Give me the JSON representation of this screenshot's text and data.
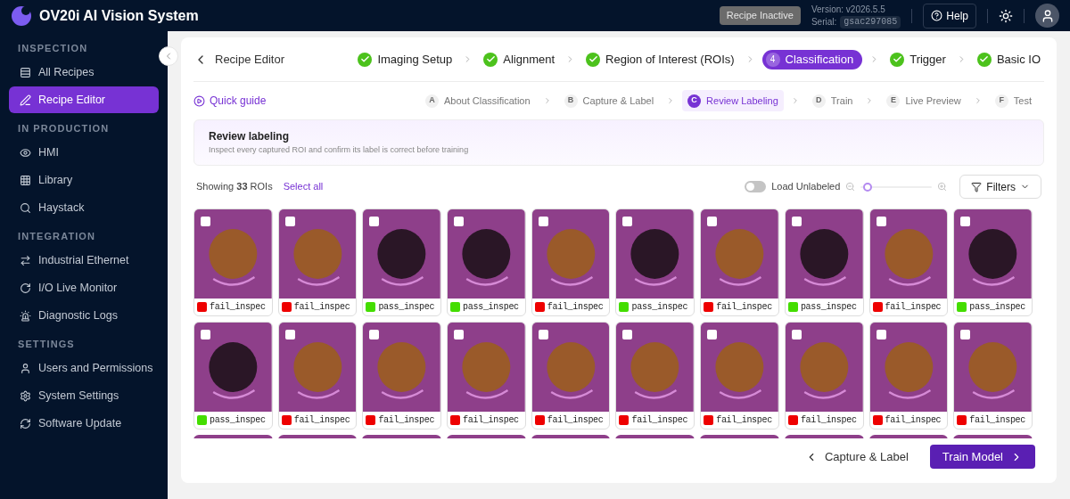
{
  "header": {
    "title": "OV20i AI Vision System",
    "status_badge": "Recipe Inactive",
    "version": "Version: v2026.5.5",
    "serial_label": "Serial:",
    "serial": "gsac297085",
    "help": "Help"
  },
  "sidebar": {
    "sections": [
      {
        "title": "INSPECTION",
        "items": [
          {
            "label": "All Recipes",
            "selected": false
          },
          {
            "label": "Recipe Editor",
            "selected": true
          }
        ]
      },
      {
        "title": "IN PRODUCTION",
        "items": [
          {
            "label": "HMI",
            "selected": false
          },
          {
            "label": "Library",
            "selected": false
          },
          {
            "label": "Haystack",
            "selected": false
          }
        ]
      },
      {
        "title": "INTEGRATION",
        "items": [
          {
            "label": "Industrial Ethernet",
            "selected": false
          },
          {
            "label": "I/O Live Monitor",
            "selected": false
          },
          {
            "label": "Diagnostic Logs",
            "selected": false
          }
        ]
      },
      {
        "title": "SETTINGS",
        "items": [
          {
            "label": "Users and Permissions",
            "selected": false
          },
          {
            "label": "System Settings",
            "selected": false
          },
          {
            "label": "Software Update",
            "selected": false
          }
        ]
      }
    ]
  },
  "editor": {
    "back": "Recipe Editor",
    "steps": [
      {
        "label": "Imaging Setup",
        "selected": false
      },
      {
        "label": "Alignment",
        "selected": false
      },
      {
        "label": "Region of Interest (ROIs)",
        "selected": false
      },
      {
        "label": "Classification",
        "number": "4",
        "selected": true
      },
      {
        "label": "Trigger",
        "selected": false
      },
      {
        "label": "Basic IO",
        "selected": false
      }
    ],
    "quick_guide": "Quick guide",
    "substeps": [
      {
        "letter": "A",
        "label": "About Classification",
        "selected": false
      },
      {
        "letter": "B",
        "label": "Capture & Label",
        "selected": false
      },
      {
        "letter": "C",
        "label": "Review Labeling",
        "selected": true
      },
      {
        "letter": "D",
        "label": "Train",
        "selected": false
      },
      {
        "letter": "E",
        "label": "Live Preview",
        "selected": false
      },
      {
        "letter": "F",
        "label": "Test",
        "selected": false
      }
    ],
    "banner": {
      "title": "Review labeling",
      "subtitle": "Inspect every captured ROI and confirm its label is correct before training"
    },
    "toolbar": {
      "showing": "Showing **33** ROIs",
      "select_all": "Select all",
      "load_unlabeled": {
        "label": "Load Unlabeled",
        "on": false
      },
      "zoom": {
        "level": 0.1
      },
      "filters": "Filters"
    },
    "tiles": [
      {
        "label": "fail_inspec",
        "color": "#ee0000",
        "checked": false,
        "kind": "fail"
      },
      {
        "label": "fail_inspec",
        "color": "#ee0000",
        "checked": false,
        "kind": "fail"
      },
      {
        "label": "pass_inspec",
        "color": "#44dd00",
        "checked": false,
        "kind": "pass"
      },
      {
        "label": "pass_inspec",
        "color": "#44dd00",
        "checked": false,
        "kind": "pass"
      },
      {
        "label": "fail_inspec",
        "color": "#ee0000",
        "checked": false,
        "kind": "fail"
      },
      {
        "label": "pass_inspec",
        "color": "#44dd00",
        "checked": false,
        "kind": "pass"
      },
      {
        "label": "fail_inspec",
        "color": "#ee0000",
        "checked": false,
        "kind": "fail"
      },
      {
        "label": "pass_inspec",
        "color": "#44dd00",
        "checked": false,
        "kind": "pass"
      },
      {
        "label": "fail_inspec",
        "color": "#ee0000",
        "checked": false,
        "kind": "fail"
      },
      {
        "label": "pass_inspec",
        "color": "#44dd00",
        "checked": false,
        "kind": "pass"
      },
      {
        "label": "pass_inspec",
        "color": "#44dd00",
        "checked": false,
        "kind": "pass"
      },
      {
        "label": "fail_inspec",
        "color": "#ee0000",
        "checked": false,
        "kind": "fail"
      },
      {
        "label": "fail_inspec",
        "color": "#ee0000",
        "checked": false,
        "kind": "fail"
      },
      {
        "label": "fail_inspec",
        "color": "#ee0000",
        "checked": false,
        "kind": "fail"
      },
      {
        "label": "fail_inspec",
        "color": "#ee0000",
        "checked": false,
        "kind": "fail"
      },
      {
        "label": "fail_inspec",
        "color": "#ee0000",
        "checked": false,
        "kind": "fail"
      },
      {
        "label": "fail_inspec",
        "color": "#ee0000",
        "checked": false,
        "kind": "fail"
      },
      {
        "label": "fail_inspec",
        "color": "#ee0000",
        "checked": false,
        "kind": "fail"
      },
      {
        "label": "fail_inspec",
        "color": "#ee0000",
        "checked": false,
        "kind": "fail"
      },
      {
        "label": "fail_inspec",
        "color": "#ee0000",
        "checked": false,
        "kind": "fail"
      }
    ],
    "footer": {
      "back": "Capture & Label",
      "next": "Train Model"
    }
  }
}
